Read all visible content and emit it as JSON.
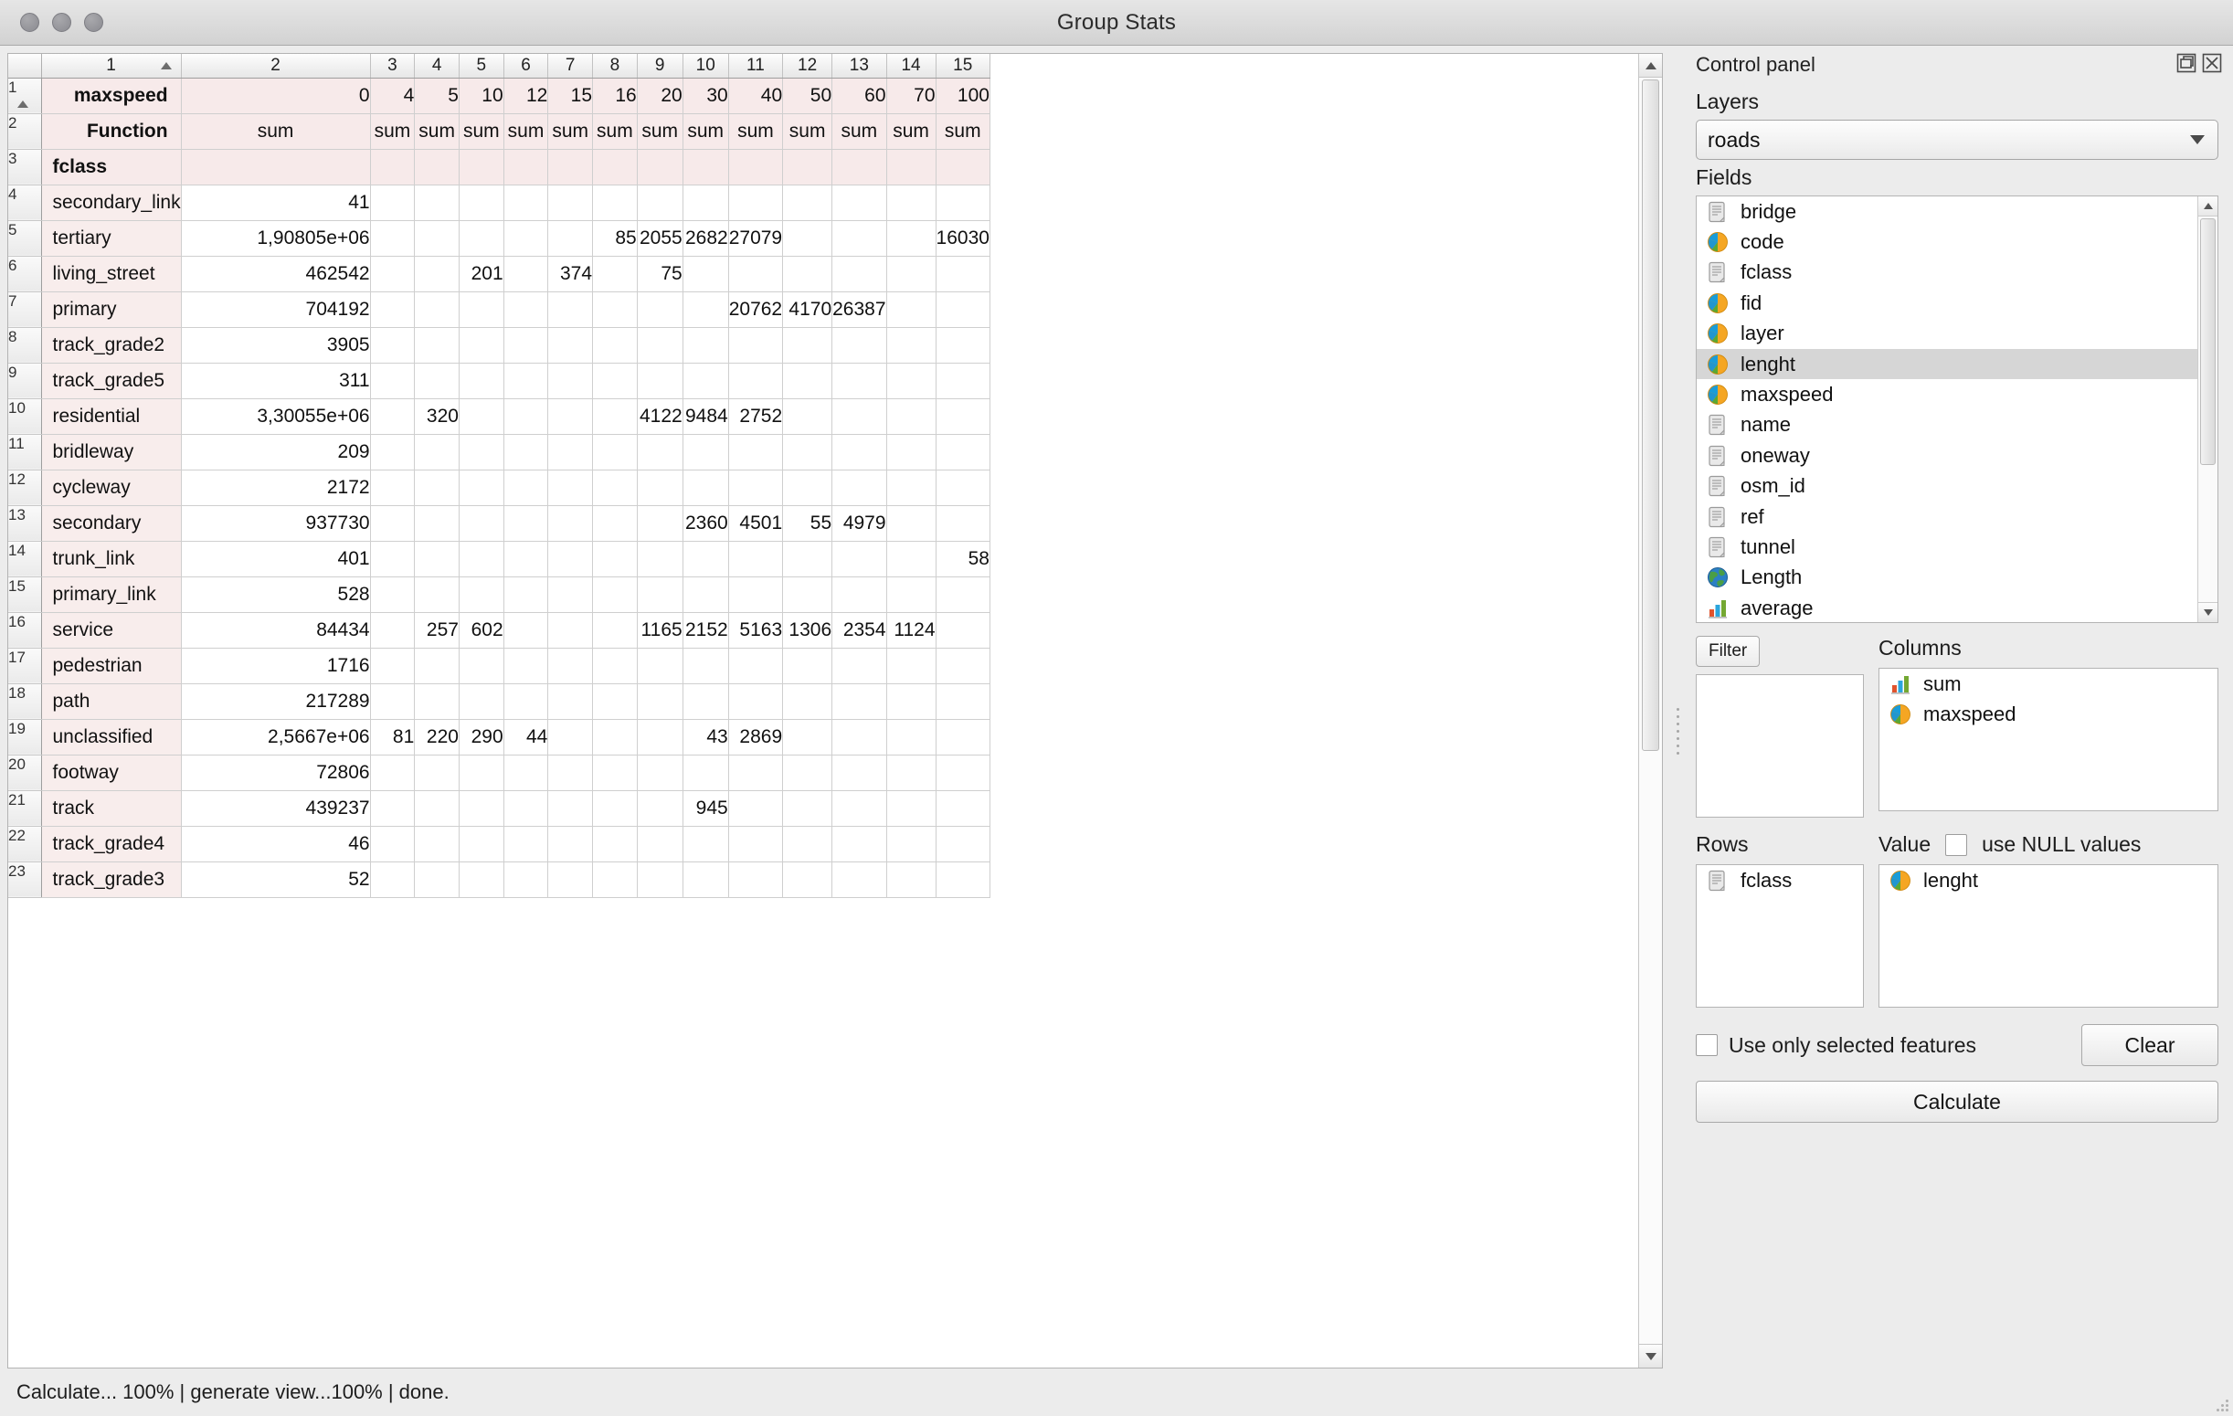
{
  "window": {
    "title": "Group Stats"
  },
  "statusbar": {
    "text": "Calculate... 100% |  generate view...100% |  done."
  },
  "sheet": {
    "column_headers": [
      "",
      "1",
      "2",
      "3",
      "4",
      "5",
      "6",
      "7",
      "8",
      "9",
      "10",
      "11",
      "12",
      "13",
      "14",
      "15"
    ],
    "rows": [
      {
        "num": "1",
        "cells": [
          "maxspeed",
          "0",
          "4",
          "5",
          "10",
          "12",
          "15",
          "16",
          "20",
          "30",
          "40",
          "50",
          "60",
          "70",
          "100"
        ]
      },
      {
        "num": "2",
        "cells": [
          "Function",
          "sum",
          "sum",
          "sum",
          "sum",
          "sum",
          "sum",
          "sum",
          "sum",
          "sum",
          "sum",
          "sum",
          "sum",
          "sum",
          "sum"
        ]
      },
      {
        "num": "3",
        "cells": [
          "fclass",
          "",
          "",
          "",
          "",
          "",
          "",
          "",
          "",
          "",
          "",
          "",
          "",
          "",
          ""
        ]
      },
      {
        "num": "4",
        "cells": [
          "secondary_link",
          "41",
          "",
          "",
          "",
          "",
          "",
          "",
          "",
          "",
          "",
          "",
          "",
          "",
          ""
        ]
      },
      {
        "num": "5",
        "cells": [
          "tertiary",
          "1,90805e+06",
          "",
          "",
          "",
          "",
          "",
          "85",
          "2055",
          "2682",
          "27079",
          "",
          "",
          "",
          "16030"
        ]
      },
      {
        "num": "6",
        "cells": [
          "living_street",
          "462542",
          "",
          "",
          "201",
          "",
          "374",
          "",
          "75",
          "",
          "",
          "",
          "",
          "",
          ""
        ]
      },
      {
        "num": "7",
        "cells": [
          "primary",
          "704192",
          "",
          "",
          "",
          "",
          "",
          "",
          "",
          "",
          "20762",
          "4170",
          "26387",
          "",
          ""
        ]
      },
      {
        "num": "8",
        "cells": [
          "track_grade2",
          "3905",
          "",
          "",
          "",
          "",
          "",
          "",
          "",
          "",
          "",
          "",
          "",
          "",
          ""
        ]
      },
      {
        "num": "9",
        "cells": [
          "track_grade5",
          "311",
          "",
          "",
          "",
          "",
          "",
          "",
          "",
          "",
          "",
          "",
          "",
          "",
          ""
        ]
      },
      {
        "num": "10",
        "cells": [
          "residential",
          "3,30055e+06",
          "",
          "320",
          "",
          "",
          "",
          "",
          "4122",
          "9484",
          "2752",
          "",
          "",
          "",
          ""
        ]
      },
      {
        "num": "11",
        "cells": [
          "bridleway",
          "209",
          "",
          "",
          "",
          "",
          "",
          "",
          "",
          "",
          "",
          "",
          "",
          "",
          ""
        ]
      },
      {
        "num": "12",
        "cells": [
          "cycleway",
          "2172",
          "",
          "",
          "",
          "",
          "",
          "",
          "",
          "",
          "",
          "",
          "",
          "",
          ""
        ]
      },
      {
        "num": "13",
        "cells": [
          "secondary",
          "937730",
          "",
          "",
          "",
          "",
          "",
          "",
          "",
          "2360",
          "4501",
          "55",
          "4979",
          "",
          ""
        ]
      },
      {
        "num": "14",
        "cells": [
          "trunk_link",
          "401",
          "",
          "",
          "",
          "",
          "",
          "",
          "",
          "",
          "",
          "",
          "",
          "",
          "58"
        ]
      },
      {
        "num": "15",
        "cells": [
          "primary_link",
          "528",
          "",
          "",
          "",
          "",
          "",
          "",
          "",
          "",
          "",
          "",
          "",
          "",
          ""
        ]
      },
      {
        "num": "16",
        "cells": [
          "service",
          "84434",
          "",
          "257",
          "602",
          "",
          "",
          "",
          "1165",
          "2152",
          "5163",
          "1306",
          "2354",
          "1124",
          ""
        ]
      },
      {
        "num": "17",
        "cells": [
          "pedestrian",
          "1716",
          "",
          "",
          "",
          "",
          "",
          "",
          "",
          "",
          "",
          "",
          "",
          "",
          ""
        ]
      },
      {
        "num": "18",
        "cells": [
          "path",
          "217289",
          "",
          "",
          "",
          "",
          "",
          "",
          "",
          "",
          "",
          "",
          "",
          "",
          ""
        ]
      },
      {
        "num": "19",
        "cells": [
          "unclassified",
          "2,5667e+06",
          "81",
          "220",
          "290",
          "44",
          "",
          "",
          "",
          "43",
          "2869",
          "",
          "",
          "",
          ""
        ]
      },
      {
        "num": "20",
        "cells": [
          "footway",
          "72806",
          "",
          "",
          "",
          "",
          "",
          "",
          "",
          "",
          "",
          "",
          "",
          "",
          ""
        ]
      },
      {
        "num": "21",
        "cells": [
          "track",
          "439237",
          "",
          "",
          "",
          "",
          "",
          "",
          "",
          "945",
          "",
          "",
          "",
          "",
          ""
        ]
      },
      {
        "num": "22",
        "cells": [
          "track_grade4",
          "46",
          "",
          "",
          "",
          "",
          "",
          "",
          "",
          "",
          "",
          "",
          "",
          "",
          ""
        ]
      },
      {
        "num": "23",
        "cells": [
          "track_grade3",
          "52",
          "",
          "",
          "",
          "",
          "",
          "",
          "",
          "",
          "",
          "",
          "",
          "",
          ""
        ]
      }
    ]
  },
  "panel": {
    "title": "Control panel",
    "layers_label": "Layers",
    "layer_selected": "roads",
    "fields_label": "Fields",
    "fields": [
      {
        "label": "bridge",
        "icon": "text-field-icon"
      },
      {
        "label": "code",
        "icon": "numeric-field-icon"
      },
      {
        "label": "fclass",
        "icon": "text-field-icon"
      },
      {
        "label": "fid",
        "icon": "numeric-field-icon"
      },
      {
        "label": "layer",
        "icon": "numeric-field-icon"
      },
      {
        "label": "lenght",
        "icon": "numeric-field-icon",
        "selected": true
      },
      {
        "label": "maxspeed",
        "icon": "numeric-field-icon"
      },
      {
        "label": "name",
        "icon": "text-field-icon"
      },
      {
        "label": "oneway",
        "icon": "text-field-icon"
      },
      {
        "label": "osm_id",
        "icon": "text-field-icon"
      },
      {
        "label": "ref",
        "icon": "text-field-icon"
      },
      {
        "label": "tunnel",
        "icon": "text-field-icon"
      },
      {
        "label": "Length",
        "icon": "globe-icon"
      },
      {
        "label": "average",
        "icon": "bar-chart-icon"
      }
    ],
    "filter_label": "Filter",
    "columns_label": "Columns",
    "columns_items": [
      {
        "label": "sum",
        "icon": "bar-chart-icon"
      },
      {
        "label": "maxspeed",
        "icon": "numeric-field-icon"
      }
    ],
    "rows_label": "Rows",
    "rows_items": [
      {
        "label": "fclass",
        "icon": "text-field-icon"
      }
    ],
    "value_label": "Value",
    "use_null_label": "use NULL values",
    "value_items": [
      {
        "label": "lenght",
        "icon": "numeric-field-icon"
      }
    ],
    "use_selected_label": "Use only selected features",
    "clear_label": "Clear",
    "calculate_label": "Calculate"
  }
}
